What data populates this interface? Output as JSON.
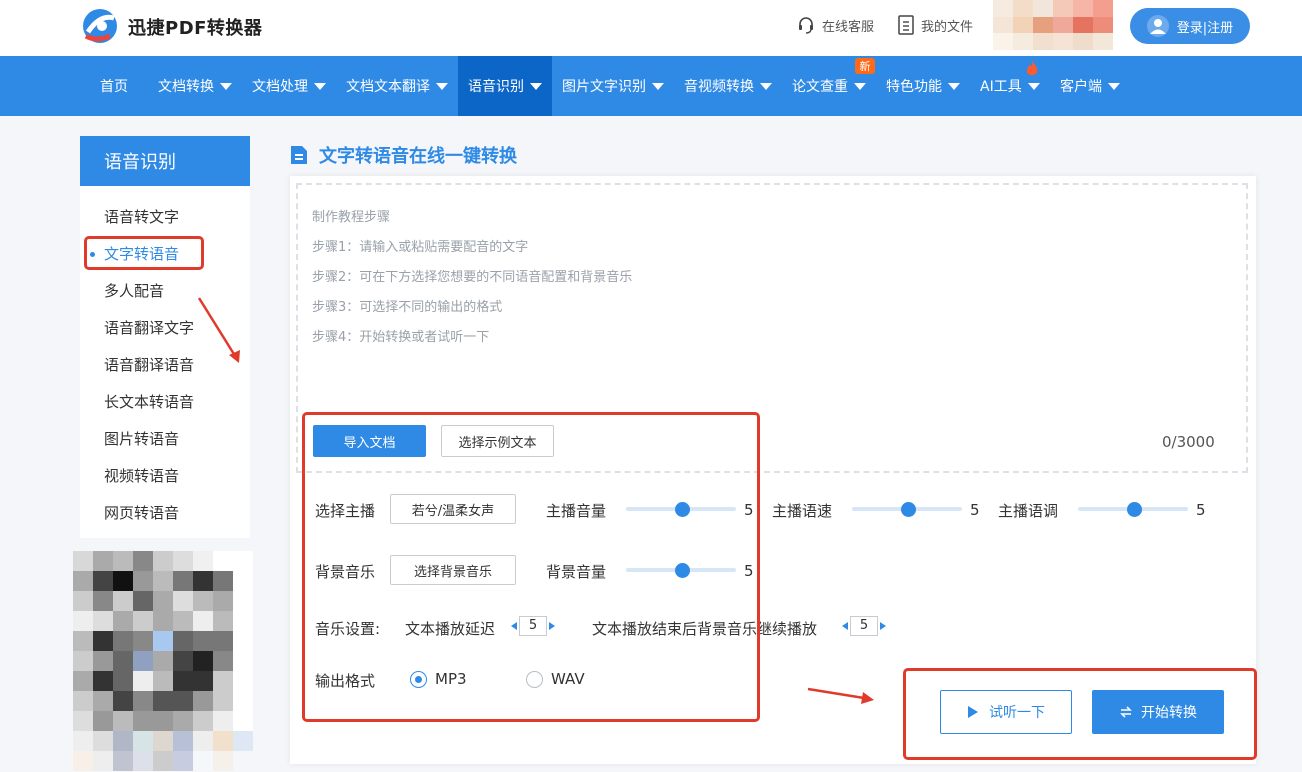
{
  "header": {
    "brand": "迅捷PDF转换器",
    "service_label": "在线客服",
    "files_label": "我的文件",
    "login_label": "登录|注册"
  },
  "nav": {
    "items": [
      {
        "label": "首页"
      },
      {
        "label": "文档转换"
      },
      {
        "label": "文档处理"
      },
      {
        "label": "文档文本翻译"
      },
      {
        "label": "语音识别"
      },
      {
        "label": "图片文字识别"
      },
      {
        "label": "音视频转换"
      },
      {
        "label": "论文查重"
      },
      {
        "label": "特色功能"
      },
      {
        "label": "AI工具"
      },
      {
        "label": "客户端"
      }
    ],
    "new_badge": "新"
  },
  "sidebar": {
    "title": "语音识别",
    "items": [
      {
        "label": "语音转文字"
      },
      {
        "label": "文字转语音"
      },
      {
        "label": "多人配音"
      },
      {
        "label": "语音翻译文字"
      },
      {
        "label": "语音翻译语音"
      },
      {
        "label": "长文本转语音"
      },
      {
        "label": "图片转语音"
      },
      {
        "label": "视频转语音"
      },
      {
        "label": "网页转语音"
      }
    ]
  },
  "main": {
    "title": "文字转语音在线一键转换",
    "steps": [
      "制作教程步骤",
      "步骤1：请输入或粘贴需要配音的文字",
      "步骤2：可在下方选择您想要的不同语音配置和背景音乐",
      "步骤3：可选择不同的输出的格式",
      "步骤4：开始转换或者试听一下"
    ],
    "import_label": "导入文档",
    "example_label": "选择示例文本",
    "char_count": "0/3000",
    "settings": {
      "anchor_label": "选择主播",
      "anchor_value": "若兮/温柔女声",
      "anchor_volume_label": "主播音量",
      "anchor_volume": "5",
      "anchor_speed_label": "主播语速",
      "anchor_speed": "5",
      "anchor_pitch_label": "主播语调",
      "anchor_pitch": "5",
      "bgm_label": "背景音乐",
      "bgm_value": "选择背景音乐",
      "bgm_volume_label": "背景音量",
      "bgm_volume": "5",
      "music_settings_label": "音乐设置:",
      "delay_label": "文本播放延迟",
      "delay_value": "5",
      "continue_label": "文本播放结束后背景音乐继续播放",
      "continue_value": "5",
      "format_label": "输出格式",
      "formats": [
        {
          "label": "MP3",
          "selected": true
        },
        {
          "label": "WAV",
          "selected": false
        }
      ]
    },
    "listen_label": "试听一下",
    "convert_label": "开始转换"
  },
  "colors": {
    "primary": "#2f8ae6",
    "nav_active": "#0b66c8",
    "annotation_red": "#e03a2a",
    "badge_orange": "#ff6a1a"
  }
}
